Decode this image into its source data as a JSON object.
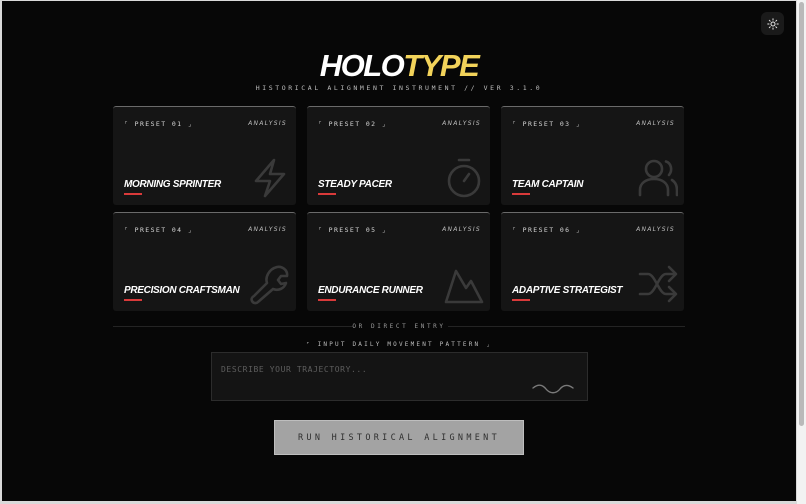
{
  "header": {
    "logo_part1": "HOLO",
    "logo_part2": "TYPE",
    "subtitle": "HISTORICAL ALIGNMENT INSTRUMENT // VER 3.1.0"
  },
  "theme_toggle": {
    "icon": "sun-icon"
  },
  "presets": [
    {
      "tag": "⌜ PRESET 01 ⌟",
      "analysis": "ANALYSIS",
      "name": "MORNING SPRINTER",
      "icon": "lightning-icon"
    },
    {
      "tag": "⌜ PRESET 02 ⌟",
      "analysis": "ANALYSIS",
      "name": "STEADY PACER",
      "icon": "stopwatch-icon"
    },
    {
      "tag": "⌜ PRESET 03 ⌟",
      "analysis": "ANALYSIS",
      "name": "TEAM CAPTAIN",
      "icon": "users-icon"
    },
    {
      "tag": "⌜ PRESET 04 ⌟",
      "analysis": "ANALYSIS",
      "name": "PRECISION CRAFTSMAN",
      "icon": "wrench-icon"
    },
    {
      "tag": "⌜ PRESET 05 ⌟",
      "analysis": "ANALYSIS",
      "name": "ENDURANCE RUNNER",
      "icon": "mountain-icon"
    },
    {
      "tag": "⌜ PRESET 06 ⌟",
      "analysis": "ANALYSIS",
      "name": "ADAPTIVE STRATEGIST",
      "icon": "shuffle-icon"
    }
  ],
  "divider": "OR DIRECT ENTRY",
  "entry": {
    "label": "⌜ INPUT DAILY MOVEMENT PATTERN ⌟",
    "placeholder": "DESCRIBE YOUR TRAJECTORY...",
    "value": ""
  },
  "run_button": "RUN HISTORICAL ALIGNMENT",
  "colors": {
    "background": "#070707",
    "card": "#151515",
    "accent_yellow": "#f2d35a",
    "accent_red": "#d93a3a",
    "button": "#a3a3a3"
  }
}
